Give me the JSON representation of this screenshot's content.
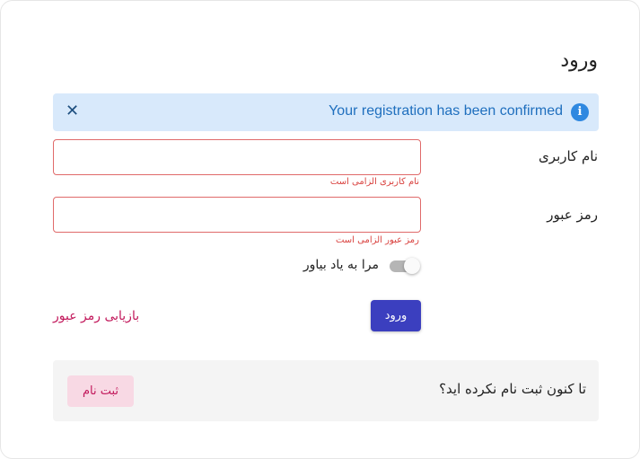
{
  "form": {
    "title": "ورود"
  },
  "alert": {
    "message": "Your registration has been confirmed",
    "info_icon": "info-icon",
    "close_icon": "close-icon",
    "close_glyph": "✕",
    "info_glyph": "i"
  },
  "fields": {
    "username": {
      "label": "نام کاربری",
      "value": "",
      "error": "نام کاربری الزامی است"
    },
    "password": {
      "label": "رمز عبور",
      "value": "",
      "error": "رمز عبور الزامی است"
    }
  },
  "remember_me": {
    "label": "مرا به یاد بیاور",
    "checked": false
  },
  "actions": {
    "login_label": "ورود",
    "forgot_password_label": "بازیابی رمز عبور"
  },
  "register": {
    "question": "تا کنون ثبت نام نکرده اید؟",
    "button_label": "ثبت نام"
  },
  "colors": {
    "primary": "#3b3fbf",
    "accent": "#c2185b",
    "error": "#d9423f",
    "info_bg": "#d8e9fb",
    "info_text": "#1f6fbe"
  }
}
